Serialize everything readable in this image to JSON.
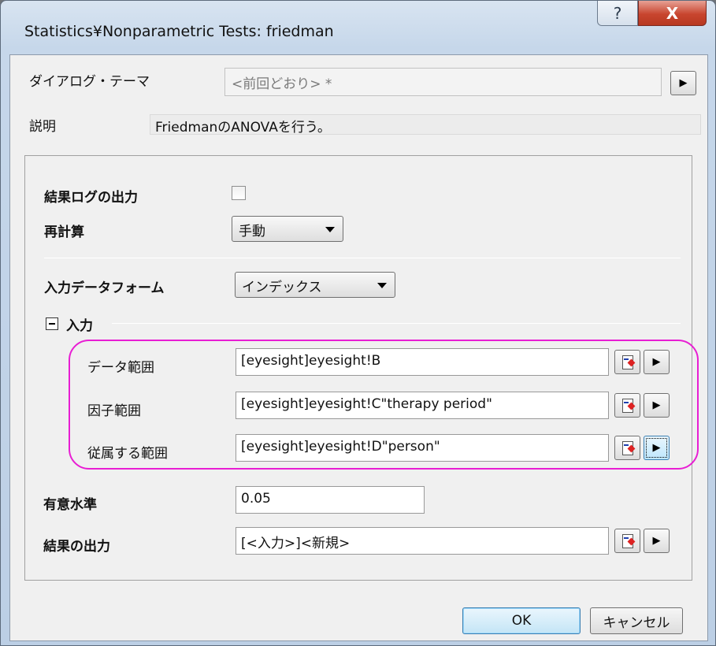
{
  "window": {
    "title": "Statistics¥Nonparametric Tests: friedman",
    "help_glyph": "?",
    "close_glyph": "X"
  },
  "theme": {
    "label": "ダイアログ・テーマ",
    "value": "<前回どおり> *",
    "arrow": "▶"
  },
  "description": {
    "label": "説明",
    "value": "FriedmanのANOVAを行う。"
  },
  "options": {
    "result_log_label": "結果ログの出力",
    "result_log_checked": false,
    "recalc_label": "再計算",
    "recalc_value": "手動",
    "input_form_label": "入力データフォーム",
    "input_form_value": "インデックス"
  },
  "input_section": {
    "label": "入力",
    "rows": [
      {
        "label": "データ範囲",
        "value": "[eyesight]eyesight!B"
      },
      {
        "label": "因子範囲",
        "value": "[eyesight]eyesight!C\"therapy period\""
      },
      {
        "label": "従属する範囲",
        "value": "[eyesight]eyesight!D\"person\""
      }
    ]
  },
  "significance": {
    "label": "有意水準",
    "value": "0.05"
  },
  "output": {
    "label": "結果の出力",
    "value": "[<入力>]<新規>"
  },
  "buttons": {
    "ok": "OK",
    "cancel": "キャンセル",
    "arrow": "▶"
  },
  "colors": {
    "highlight": "#e81ed3",
    "close_button": "#c8452f"
  }
}
